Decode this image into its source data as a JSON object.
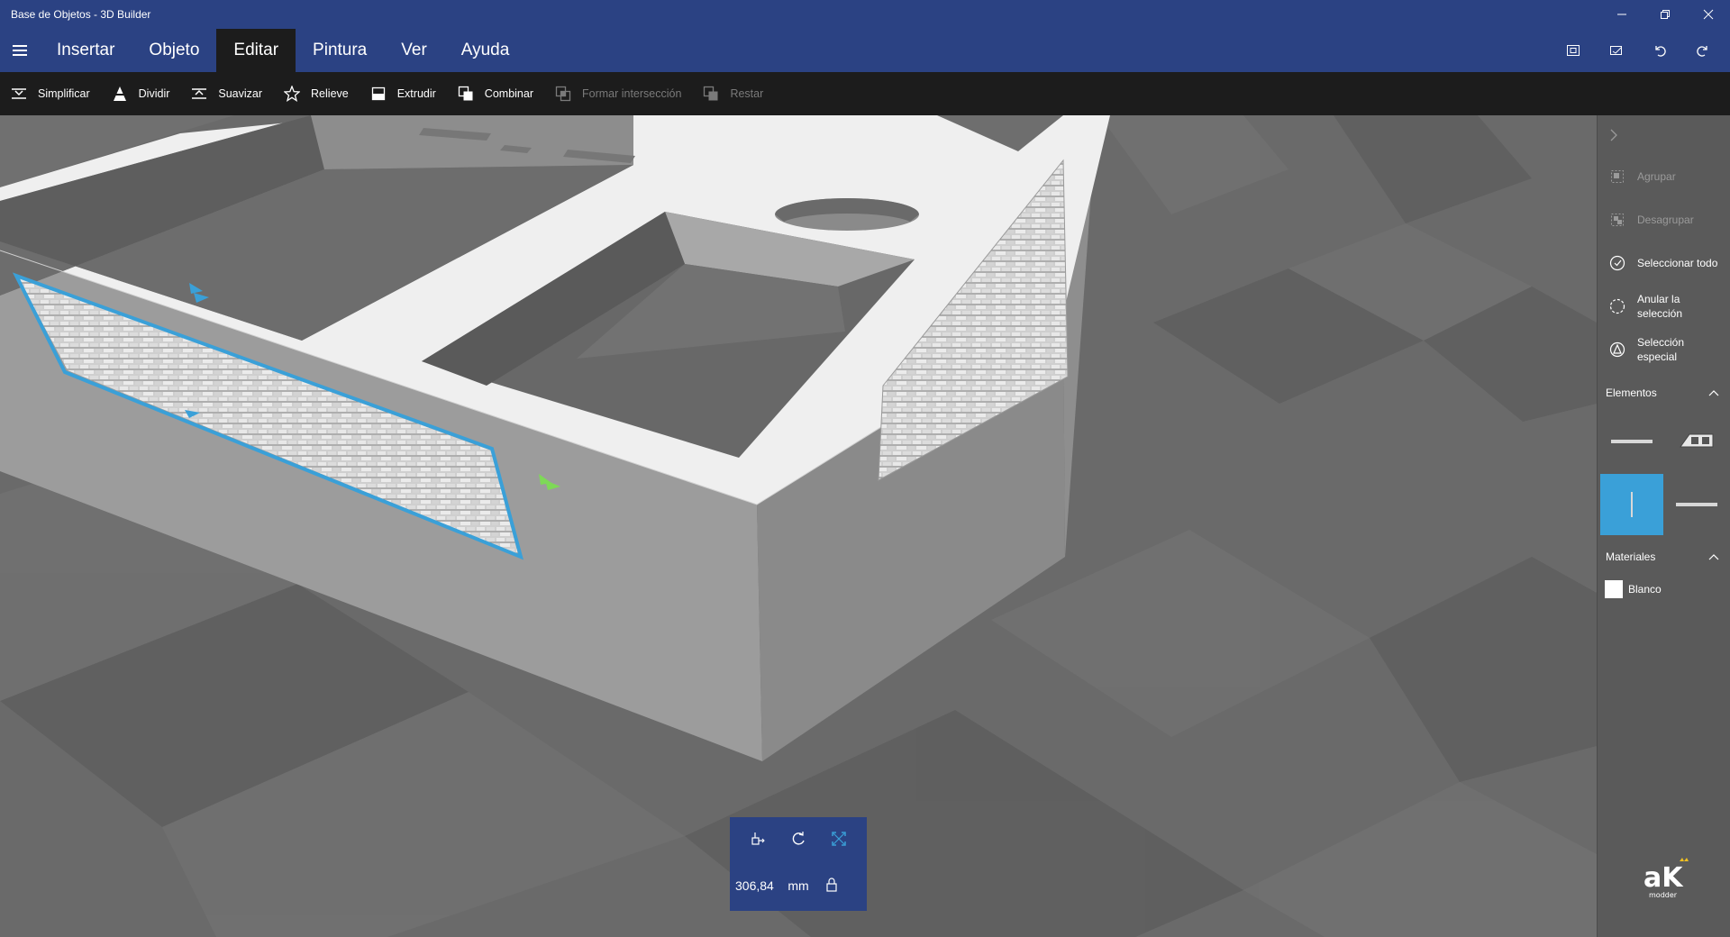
{
  "window": {
    "title": "Base de Objetos - 3D Builder"
  },
  "menu": {
    "items": [
      {
        "label": "Insertar"
      },
      {
        "label": "Objeto"
      },
      {
        "label": "Editar"
      },
      {
        "label": "Pintura"
      },
      {
        "label": "Ver"
      },
      {
        "label": "Ayuda"
      }
    ],
    "active": "Editar"
  },
  "toolbar": {
    "simplificar": "Simplificar",
    "dividir": "Dividir",
    "suavizar": "Suavizar",
    "relieve": "Relieve",
    "extrudir": "Extrudir",
    "combinar": "Combinar",
    "formar_interseccion": "Formar intersección",
    "restar": "Restar"
  },
  "panel": {
    "agrupar": "Agrupar",
    "desagrupar": "Desagrupar",
    "seleccionar_todo": "Seleccionar todo",
    "anular_seleccion": "Anular la selección",
    "seleccion_especial": "Selección especial",
    "elementos_header": "Elementos",
    "materiales_header": "Materiales",
    "material_blanco": "Blanco"
  },
  "transform": {
    "value": "306,84",
    "unit": "mm"
  },
  "logo": {
    "text": "modder"
  },
  "colors": {
    "header_blue": "#2b4283",
    "toolbar_dark": "#1c1c1c",
    "selection_blue": "#3aa0d8",
    "gizmo_green": "#7ed957"
  }
}
